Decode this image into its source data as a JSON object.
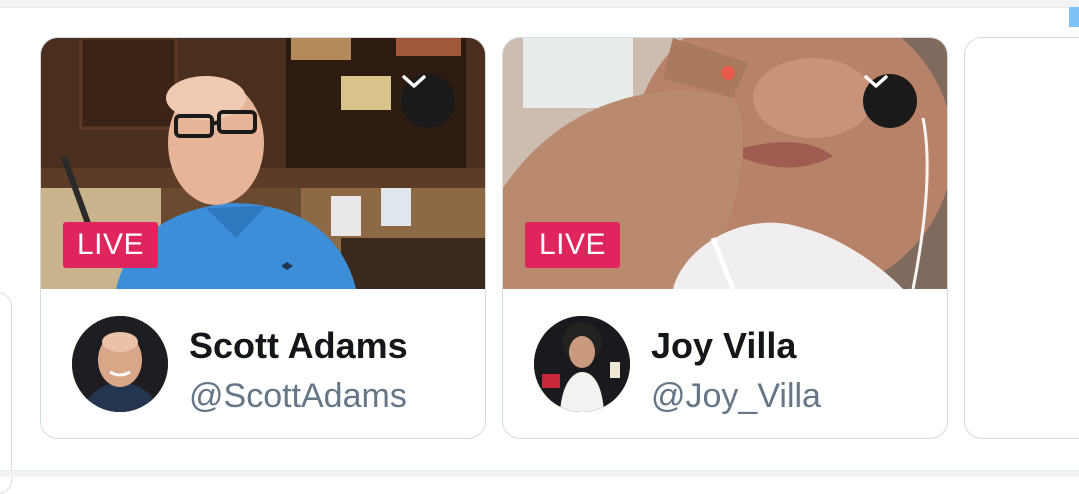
{
  "live_label": "LIVE",
  "colors": {
    "live_badge": "#e0245e",
    "name_text": "#14171a",
    "handle_text": "#657786",
    "card_border": "#d3dbe1"
  },
  "cards": [
    {
      "name": "Scott Adams",
      "handle": "@ScottAdams",
      "live": true,
      "menu_icon": "chevron-down-icon"
    },
    {
      "name": "Joy Villa",
      "handle": "@Joy_Villa",
      "live": true,
      "menu_icon": "chevron-down-icon"
    }
  ]
}
